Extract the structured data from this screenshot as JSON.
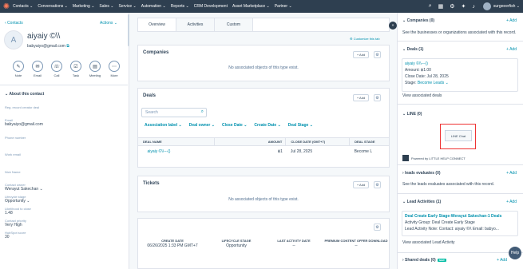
{
  "nav": {
    "items": [
      "Contacts ⌄",
      "Conversations ⌄",
      "Marketing ⌄",
      "Sales ⌄",
      "Service ⌄",
      "Automation ⌄",
      "Reports ⌄",
      "CRM Development",
      "Asset Marketplace ⌄",
      "Partner ⌄"
    ],
    "user": "surgeeerfish ⌄"
  },
  "left": {
    "back_link": "‹ Contacts",
    "actions": "Actions ⌄",
    "avatar_initial": "A",
    "name": "aiyaiy ©\\\\",
    "email": "babyaiyo@gmail.com",
    "activities": [
      "Note",
      "Email",
      "Call",
      "Task",
      "Meeting",
      "More"
    ],
    "about_title": "⌄  About this contact",
    "fields": [
      {
        "label": "Reg. record creator deal",
        "value": ""
      },
      {
        "label": "Email",
        "value": "babyaiyo@gmail.com"
      },
      {
        "label": "Phone number",
        "value": ""
      },
      {
        "label": "Work email",
        "value": ""
      },
      {
        "label": "Nick Name",
        "value": ""
      },
      {
        "label": "Contact owner",
        "value": "Werayut Sakechan ⌄"
      },
      {
        "label": "Lifecycle stage",
        "value": "Opportunity ⌄"
      },
      {
        "label": "Likelihood to close",
        "value": "1.48"
      },
      {
        "label": "Contact priority",
        "value": "Very High"
      },
      {
        "label": "HubSpot score",
        "value": "30"
      }
    ]
  },
  "tabs": [
    "Overview",
    "Activities",
    "Custom"
  ],
  "customize": "⚙ Customize this tab",
  "companies": {
    "title": "Companies",
    "add": "+ Add",
    "empty": "No associated objects of this type exist."
  },
  "deals": {
    "title": "Deals",
    "add": "+ Add",
    "search_placeholder": "Search",
    "filters": [
      "Association label ⌄",
      "Deal owner ⌄",
      "Close Date ⌄",
      "Create Date ⌄",
      "Deal Stage ⌄"
    ],
    "headers": [
      "DEAL NAME",
      "AMOUNT",
      "CLOSE DATE (GMT+7)",
      "DEAL STAGE"
    ],
    "rows": [
      [
        "aiyaiy ©\\\\---()",
        "฿1",
        "Jul 28, 2025",
        "Become L"
      ]
    ]
  },
  "tickets": {
    "title": "Tickets",
    "add": "+ Add",
    "empty": "No associated objects of this type exist."
  },
  "bottom": {
    "headers": [
      "CREATE DATE",
      "LIFECYCLE STAGE",
      "LAST ACTIVITY DATE",
      "PREMIUM CONTENT OFFER DOWNLOAD"
    ],
    "row": [
      "06/26/2025 1:33 PM GMT+7",
      "Opportunity",
      "--",
      "--"
    ]
  },
  "right": {
    "companies_title": "⌄  Companies (0)",
    "companies_add": "+ Add",
    "companies_text": "See the businesses or organizations associated with this record.",
    "deals_title": "⌄  Deals (1)",
    "deals_add": "+ Add",
    "deal": {
      "name": "aiyaiy ©\\\\---()",
      "amount": "Amount: ฿1.00",
      "close": "Close Date: Jul 28, 2025",
      "stage_label": "Stage:",
      "stage_value": "Become Leads ⌄"
    },
    "view_deals": "View associated deals",
    "line_title": "⌄  LINE (0)",
    "line_button": "LINE Chat",
    "powered": "Powered by LITTLE HELP CONNECT",
    "leads_title": "›  leads evaluates (0)",
    "leads_add": "+ Add",
    "leads_text": "See the leads evaluates associated with this record.",
    "activities_title": "⌄  Lead Activities (1)",
    "activities_add": "+ Add",
    "activity_name": "Deal Create Early Stage-Werayut Sakechan-1 Deals",
    "activity_group": "Activity Group: Deal Create Early Stage",
    "activity_workflow": "Lead Activity Note: Contact: aiyaiy ©\\\\ Email: babyo...",
    "view_activity": "View associated Lead Activity",
    "shared_title": "›  Shared deals (0)",
    "shared_badge": "NEW",
    "shared_add": "+ Add"
  },
  "help": "Help"
}
